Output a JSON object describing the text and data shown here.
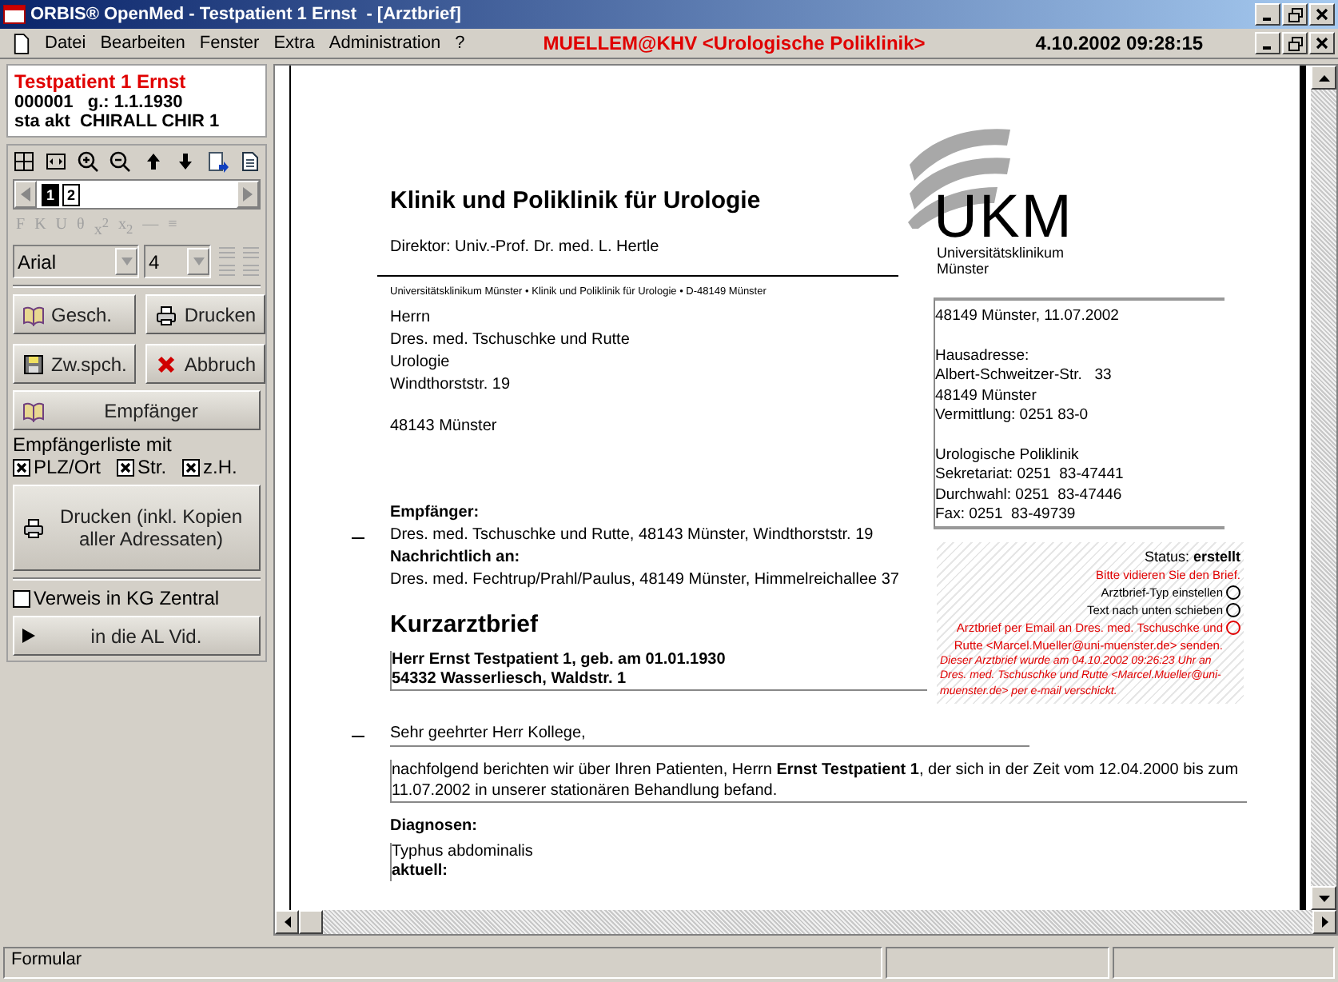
{
  "window": {
    "title": "ORBIS® OpenMed - Testpatient 1 Ernst  - [Arztbrief]"
  },
  "menu": {
    "items": [
      "Datei",
      "Bearbeiten",
      "Fenster",
      "Extra",
      "Administration",
      "?"
    ],
    "user": "MUELLEM@KHV <Urologische Poliklinik>",
    "datetime": "4.10.2002 09:28:15"
  },
  "patient": {
    "name": "Testpatient 1 Ernst",
    "line_2": "000001   g.: 1.1.1930",
    "line_3": "sta akt  CHIRALL CHIR 1"
  },
  "pages": [
    {
      "label": "1",
      "selected": true
    },
    {
      "label": "2",
      "selected": false
    }
  ],
  "format_buttons": [
    {
      "label": "F",
      "disabled": true
    },
    {
      "label": "K",
      "disabled": true
    },
    {
      "label": "U",
      "disabled": true
    },
    {
      "label": "θ",
      "disabled": true
    },
    {
      "label": "x$^{2}$",
      "disabled": true
    },
    {
      "label": "x$_{2}$",
      "disabled": true
    },
    {
      "label": "—",
      "disabled": true
    },
    {
      "label": "≡",
      "disabled": true
    }
  ],
  "font": {
    "family": "Arial",
    "size": "4"
  },
  "buttons": [
    {
      "label": "Gesch.",
      "kind": "book"
    },
    {
      "label": "Drucken",
      "kind": "printer"
    },
    {
      "label": "Zw.spch.",
      "kind": "disk"
    },
    {
      "label": "Abbruch",
      "kind": "cancel"
    }
  ],
  "recipients_button": "Empfänger",
  "recipient_list": {
    "label": "Empfängerliste mit",
    "options": [
      {
        "label": "PLZ/Ort",
        "checked": true
      },
      {
        "label": "Str.",
        "checked": true
      },
      {
        "label": "z.H.",
        "checked": true
      }
    ]
  },
  "print_all_button": "Drucken (inkl. Kopien aller Adressaten)",
  "kg_checkbox": {
    "label": "Verweis in KG Zentral",
    "checked": false
  },
  "al_button": "in die AL Vid.",
  "document": {
    "clinic": "Klinik und Poliklinik für Urologie",
    "director": "Direktor: Univ.-Prof. Dr. med.  L. Hertle",
    "logo": {
      "initials": "UKM",
      "name_line_1": "Universitätsklinikum",
      "name_line_2": "Münster"
    },
    "sender_line": "Universitätsklinikum Münster • Klinik und Poliklinik für Urologie • D-48149 Münster",
    "address": [
      "Herrn",
      "Dres. med. Tschuschke und Rutte",
      "Urologie",
      "Windthorststr. 19"
    ],
    "city": "48143 Münster",
    "info_groups": [
      {
        "lines": [
          "48149 Münster, 11.07.2002"
        ]
      },
      {
        "lines": [
          "Hausadresse:",
          "Albert-Schweitzer-Str.   33",
          "48149 Münster",
          "Vermittlung: 0251 83-0"
        ]
      },
      {
        "lines": [
          "Urologische Poliklinik",
          "Sekretariat: 0251  83-47441",
          "Durchwahl: 0251  83-47446",
          "Fax: 0251  83-49739"
        ]
      }
    ],
    "recipient_heading": "Empfänger:",
    "recipient": "Dres. med. Tschuschke und Rutte, 48143 Münster, Windthorststr. 19",
    "cc_heading": "Nachrichtlich an:",
    "cc": "Dres. med. Fechtrup/Prahl/Paulus, 48149 Münster, Himmelreichallee 37",
    "letter_type": "Kurzarztbrief",
    "patient_lines": [
      "Herr Ernst Testpatient 1, geb. am 01.01.1930",
      "54332 Wasserliesch, Waldstr. 1"
    ],
    "salutation": "Sehr geehrter Herr Kollege,",
    "intro": "nachfolgend berichten wir über Ihren Patienten, Herrn **Ernst Testpatient 1**, der sich in der Zeit vom 12.04.2000 bis zum 11.07.2002 in unserer stationären Behandlung befand.",
    "diagnoses_heading": "Diagnosen:",
    "diagnoses": [
      {
        "text": "Typhus abdominalis",
        "kind": "plain"
      },
      {
        "text": "aktuell:",
        "kind": "heading"
      }
    ]
  },
  "status_panel": {
    "status": "Status: **erstellt**",
    "notice": "Bitte vidieren Sie den Brief.",
    "actions": [
      {
        "label": "Arztbrief-Typ einstellen",
        "color": "#000000"
      },
      {
        "label": "Text nach unten schieben",
        "color": "#000000"
      },
      {
        "label": "Arztbrief per Email an Dres. med. Tschuschke und Rutte <Marcel.Mueller@uni-muenster.de> senden.",
        "color": "#e00000"
      }
    ],
    "sent_note": "Dieser Arztbrief wurde am 04.10.2002 09:26:23 Uhr an Dres. med. Tschuschke und Rutte <Marcel.Mueller@uni-muenster.de> per e-mail verschickt."
  },
  "status_bar": {
    "text": "Formular"
  }
}
